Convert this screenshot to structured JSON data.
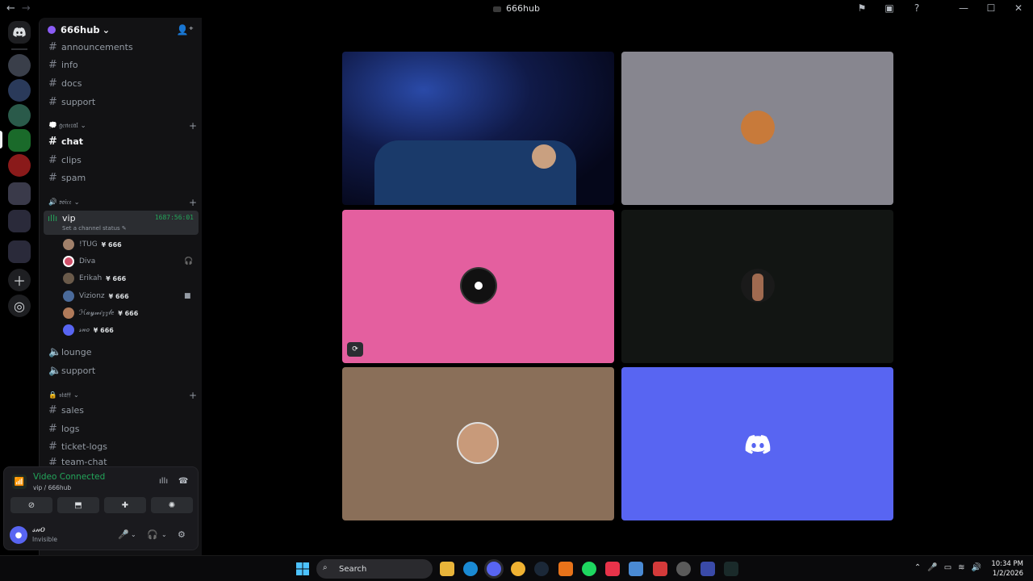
{
  "window": {
    "title": "666hub",
    "nav_back": "←",
    "nav_forward": "→"
  },
  "titlebar_icons": [
    "inbox-flag-icon",
    "inbox-icon",
    "help-icon"
  ],
  "window_controls": [
    "—",
    "☐",
    "✕"
  ],
  "server": {
    "name": "666hub",
    "chevron": "⌄"
  },
  "channels_top": [
    {
      "name": "announcements"
    },
    {
      "name": "info"
    },
    {
      "name": "docs"
    },
    {
      "name": "support"
    }
  ],
  "categories": {
    "general": "💭 𝔤𝔢𝔫𝔢𝔯𝔞𝔩",
    "voice": "🔊 𝔳𝔬𝔦𝔠𝔢",
    "staff": "🔒 𝔰𝔱𝔞𝔣𝔣"
  },
  "general_channels": [
    {
      "name": "chat",
      "active": true
    },
    {
      "name": "clips"
    },
    {
      "name": "spam"
    }
  ],
  "voice_active": {
    "name": "vip",
    "timer": "1687:56:01",
    "status": "Set a channel status ✎"
  },
  "voice_users": [
    {
      "name": "!TUG",
      "badge": "¥ 666",
      "avatar_color": "#a0806a"
    },
    {
      "name": "Diva",
      "badge": "",
      "avatar_color": "#d0506a"
    },
    {
      "name": "Erikah",
      "badge": "¥ 666",
      "avatar_color": "#6a5a4a"
    },
    {
      "name": "Vizionz",
      "badge": "¥ 666",
      "avatar_color": "#4a6a9a"
    },
    {
      "name": "ℋ𝒶𝓎𝓌𝒾𝓏𝓏𝓁𝑒",
      "badge": "¥ 666",
      "avatar_color": "#b07a5a"
    },
    {
      "name": "𝓈𝓃𝑜",
      "badge": "¥ 666",
      "avatar_color": "#5865f2"
    }
  ],
  "voice_channels": [
    {
      "name": "lounge"
    },
    {
      "name": "support"
    }
  ],
  "staff_channels": [
    {
      "name": "sales"
    },
    {
      "name": "logs"
    },
    {
      "name": "ticket-logs"
    },
    {
      "name": "team-chat"
    }
  ],
  "voice_panel": {
    "state": "Video Connected",
    "location": "vip / 666hub"
  },
  "user": {
    "name": "𝓈𝓃𝑜",
    "status": "Invisible"
  },
  "tiles": [
    {
      "kind": "video",
      "bg": "#10183a"
    },
    {
      "kind": "avatar",
      "bg": "#87868f",
      "avatar_color": "#c87a3a"
    },
    {
      "kind": "avatar",
      "bg": "#e45f9f",
      "avatar_color": "#111111"
    },
    {
      "kind": "avatar",
      "bg": "#121513",
      "avatar_color": "#7a4a3a"
    },
    {
      "kind": "avatar",
      "bg": "#8a6f59",
      "avatar_color": "#c89a7a"
    },
    {
      "kind": "discord",
      "bg": "#5865f2",
      "avatar_color": "#5865f2"
    }
  ],
  "taskbar": {
    "search_placeholder": "Search",
    "time": "10:34 PM",
    "date": "1/2/2026"
  },
  "colors": {
    "accent": "#5865f2",
    "connected": "#23a55a"
  }
}
